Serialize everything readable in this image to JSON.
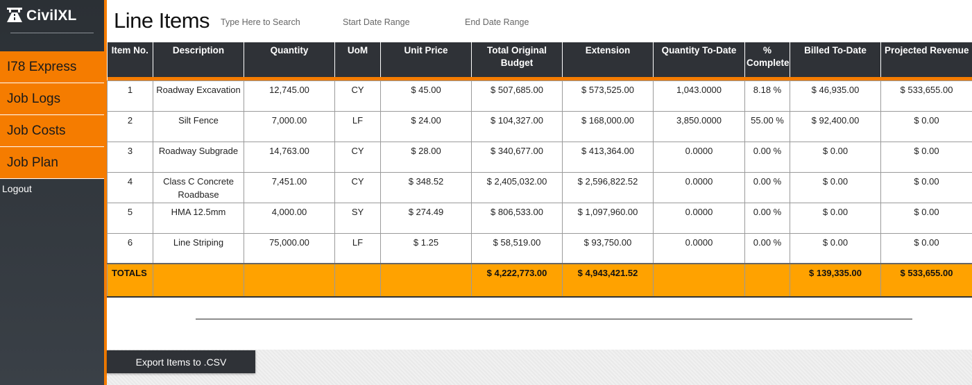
{
  "app": {
    "logo_text": "CivilXL",
    "logo_icon": "highway-icon"
  },
  "sidebar": {
    "items": [
      {
        "label": "I78 Express"
      },
      {
        "label": "Job Logs"
      },
      {
        "label": "Job Costs"
      },
      {
        "label": "Job Plan"
      }
    ],
    "logout_label": "Logout"
  },
  "header": {
    "title": "Line Items",
    "search_placeholder": "Type Here to Search",
    "start_date_placeholder": "Start Date Range",
    "end_date_placeholder": "End Date Range"
  },
  "table": {
    "columns": [
      "Item No.",
      "Description",
      "Quantity",
      "UoM",
      "Unit Price",
      "Total Original Budget",
      "Extension",
      "Quantity To-Date",
      "% Complete",
      "Billed To-Date",
      "Projected Revenue"
    ],
    "rows": [
      [
        "1",
        "Roadway Excavation",
        "12,745.00",
        "CY",
        "$ 45.00",
        "$ 507,685.00",
        "$ 573,525.00",
        "1,043.0000",
        "8.18 %",
        "$ 46,935.00",
        "$ 533,655.00"
      ],
      [
        "2",
        "Silt Fence",
        "7,000.00",
        "LF",
        "$ 24.00",
        "$ 104,327.00",
        "$ 168,000.00",
        "3,850.0000",
        "55.00 %",
        "$ 92,400.00",
        "$ 0.00"
      ],
      [
        "3",
        "Roadway Subgrade",
        "14,763.00",
        "CY",
        "$ 28.00",
        "$ 340,677.00",
        "$ 413,364.00",
        "0.0000",
        "0.00 %",
        "$ 0.00",
        "$ 0.00"
      ],
      [
        "4",
        "Class C Concrete Roadbase",
        "7,451.00",
        "CY",
        "$ 348.52",
        "$ 2,405,032.00",
        "$ 2,596,822.52",
        "0.0000",
        "0.00 %",
        "$ 0.00",
        "$ 0.00"
      ],
      [
        "5",
        "HMA 12.5mm",
        "4,000.00",
        "SY",
        "$ 274.49",
        "$ 806,533.00",
        "$ 1,097,960.00",
        "0.0000",
        "0.00 %",
        "$ 0.00",
        "$ 0.00"
      ],
      [
        "6",
        "Line Striping",
        "75,000.00",
        "LF",
        "$ 1.25",
        "$ 58,519.00",
        "$ 93,750.00",
        "0.0000",
        "0.00 %",
        "$ 0.00",
        "$ 0.00"
      ]
    ],
    "totals": [
      "TOTALS",
      "",
      "",
      "",
      "",
      "$ 4,222,773.00",
      "$ 4,943,421.52",
      "",
      "",
      "$ 139,335.00",
      "$ 533,655.00"
    ]
  },
  "export_label": "Export Items to .CSV",
  "colors": {
    "accent": "#f57c00",
    "totals": "#ffa200",
    "header_bg": "#2f3237",
    "sidebar_bg": "#2b3035"
  }
}
